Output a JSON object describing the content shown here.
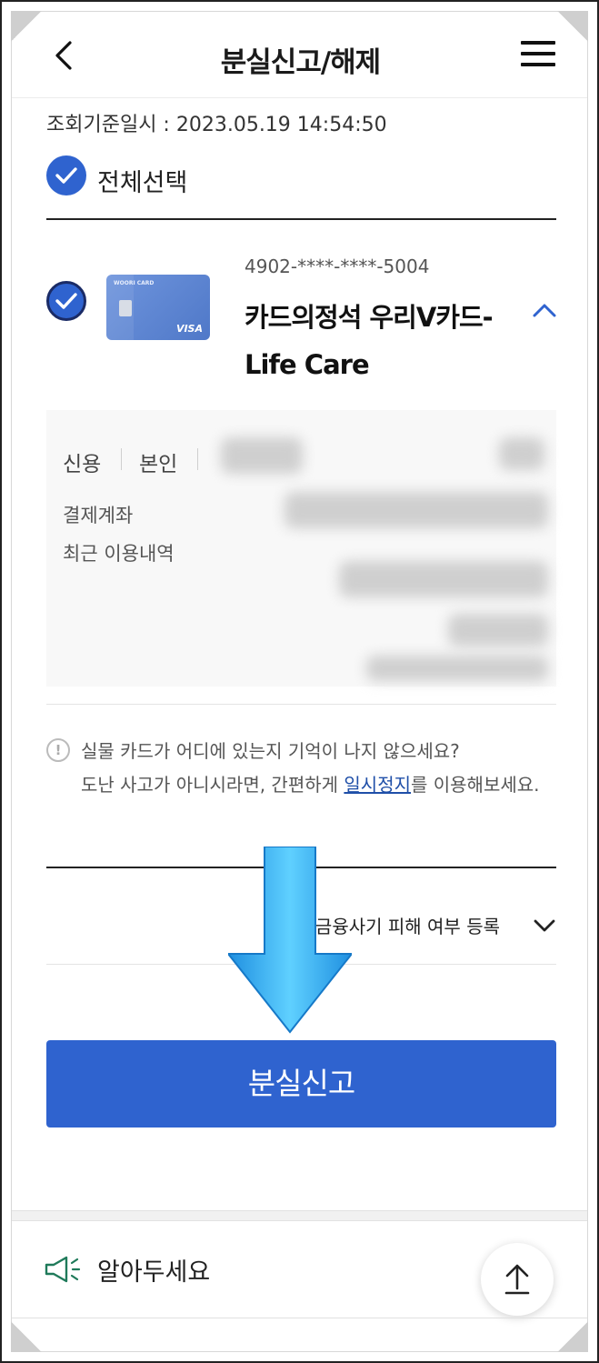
{
  "header": {
    "title": "분실신고/해제",
    "back_icon": "chevron-left-icon",
    "menu_icon": "hamburger-menu-icon"
  },
  "query": {
    "time": "조회기준일시 : 2023.05.19 14:54:50"
  },
  "select_all": {
    "label": "전체선택",
    "checked": true
  },
  "card": {
    "number": "4902-****-****-5004",
    "name": "카드의정석 우리V카드-Life Care",
    "checked": true,
    "brand": "VISA",
    "image_text": "WOORI CARD"
  },
  "details": {
    "type": "신용",
    "owner": "본인",
    "payment_account_label": "결제계좌",
    "recent_usage_label": "최근 이용내역"
  },
  "notice": {
    "line1": "실물 카드가 어디에 있는지 기억이 나지 않으세요?",
    "line2_pre": "도난 사고가 아니시라면, 간편하게 ",
    "link": "일시정지",
    "line2_post": "를 이용해보세요."
  },
  "accordion": {
    "label": "금융사기 피해 여부 등록"
  },
  "primary_button": {
    "label": "분실신고"
  },
  "footer": {
    "notice_label": "알아두세요"
  },
  "colors": {
    "accent": "#2f63cf",
    "link": "#1f4fa8",
    "annotation_arrow": "#37aef0"
  }
}
